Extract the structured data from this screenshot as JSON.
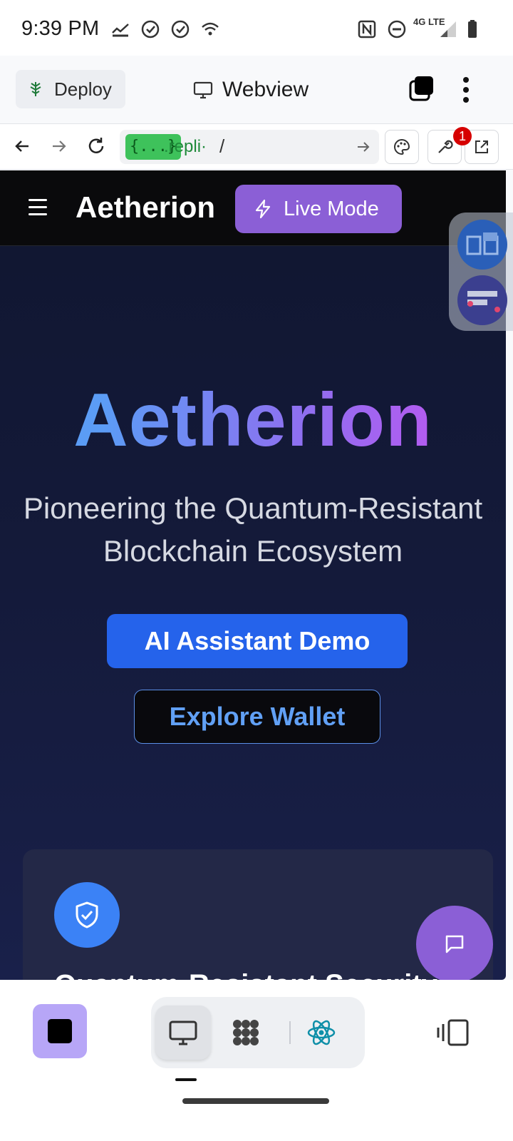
{
  "status_bar": {
    "time": "9:39 PM",
    "network": "4G LTE"
  },
  "replit_bar": {
    "deploy_label": "Deploy",
    "title": "Webview"
  },
  "url_bar": {
    "chip": "{...}",
    "host": ".repli·",
    "path": "/",
    "badge_count": "1"
  },
  "app": {
    "brand": "Aetherion",
    "live_mode_label": "Live Mode",
    "hero_title": "Aetherion",
    "hero_subtitle": "Pioneering the Quantum-Resistant Blockchain Ecosystem",
    "primary_cta": "AI Assistant Demo",
    "secondary_cta": "Explore Wallet",
    "feature_title": "Quantum-Resistant Security"
  },
  "colors": {
    "accent_purple": "#8b5fd6",
    "primary_blue": "#2563eb",
    "outline_blue": "#61a0f5",
    "background_navy": "#141a3a"
  }
}
